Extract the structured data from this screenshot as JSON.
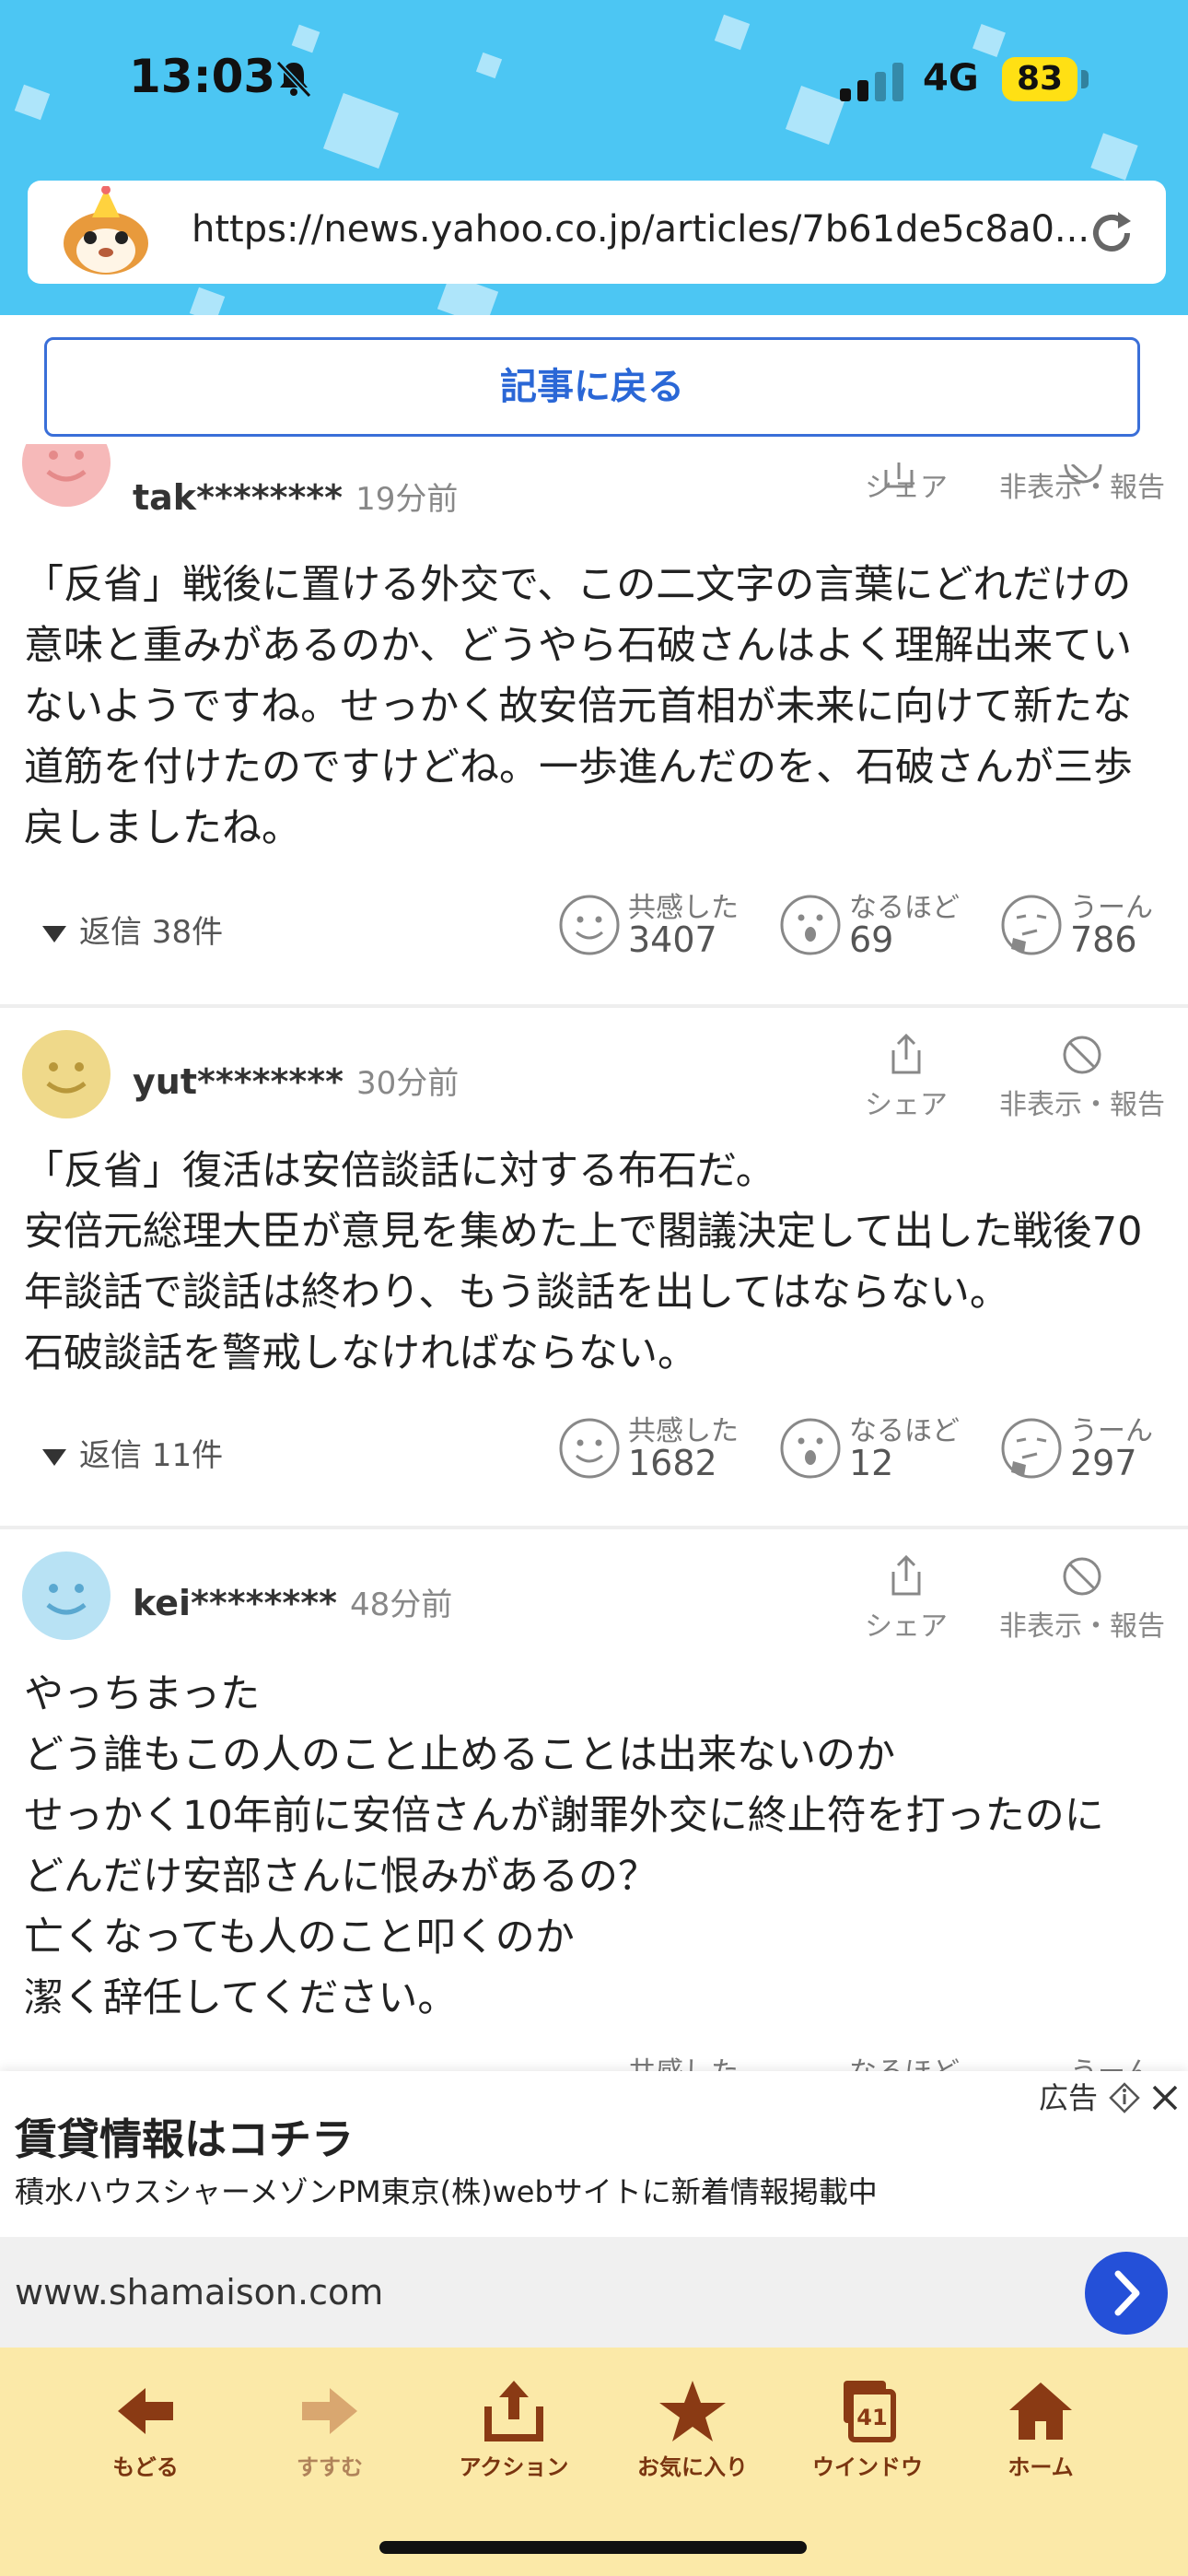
{
  "status_bar": {
    "time": "13:03",
    "network": "4G",
    "battery": "83"
  },
  "browser": {
    "url": "https://news.yahoo.co.jp/articles/7b61de5c8a0..."
  },
  "back_button": "記事に戻る",
  "comments": [
    {
      "username": "tak********",
      "time": "19分前",
      "avatar_color": "#f6b9b9",
      "share_label": "シェア",
      "hide_label": "非表示・報告",
      "body": "「反省」戦後に置ける外交で、この二文字の言葉にどれだけの意味と重みがあるのか、どうやら石破さんはよく理解出来ていないようですね。せっかく故安倍元首相が未来に向けて新たな道筋を付けたのですけどね。一歩進んだのを、石破さんが三歩戻しましたね。",
      "replies": "返信 38件",
      "reactions": [
        {
          "label": "共感した",
          "count": "3407"
        },
        {
          "label": "なるほど",
          "count": "69"
        },
        {
          "label": "うーん",
          "count": "786"
        }
      ]
    },
    {
      "username": "yut********",
      "time": "30分前",
      "avatar_color": "#efd98a",
      "share_label": "シェア",
      "hide_label": "非表示・報告",
      "body": "「反省」復活は安倍談話に対する布石だ。\n安倍元総理大臣が意見を集めた上で閣議決定して出した戦後70年談話で談話は終わり、もう談話を出してはならない。\n石破談話を警戒しなければならない。",
      "replies": "返信 11件",
      "reactions": [
        {
          "label": "共感した",
          "count": "1682"
        },
        {
          "label": "なるほど",
          "count": "12"
        },
        {
          "label": "うーん",
          "count": "297"
        }
      ]
    },
    {
      "username": "kei********",
      "time": "48分前",
      "avatar_color": "#b8e2f4",
      "share_label": "シェア",
      "hide_label": "非表示・報告",
      "body": "やっちまった\nどう誰もこの人のこと止めることは出来ないのか\nせっかく10年前に安倍さんが謝罪外交に終止符を打ったのに\nどんだけ安部さんに恨みがあるの？\n亡くなっても人のこと叩くのか\n潔く辞任してください。",
      "reactions": [
        {
          "label": "共感した"
        },
        {
          "label": "なるほど"
        },
        {
          "label": "うーん"
        }
      ]
    }
  ],
  "ad": {
    "label": "広告",
    "title": "賃貸情報はコチラ",
    "description": "積水ハウスシャーメゾンPM東京(株)webサイトに新着情報掲載中",
    "domain": "www.shamaison.com"
  },
  "toolbar": {
    "back": "もどる",
    "forward": "すすむ",
    "action": "アクション",
    "favorites": "お気に入り",
    "window": "ウインドウ",
    "window_count": "41",
    "home": "ホーム"
  }
}
